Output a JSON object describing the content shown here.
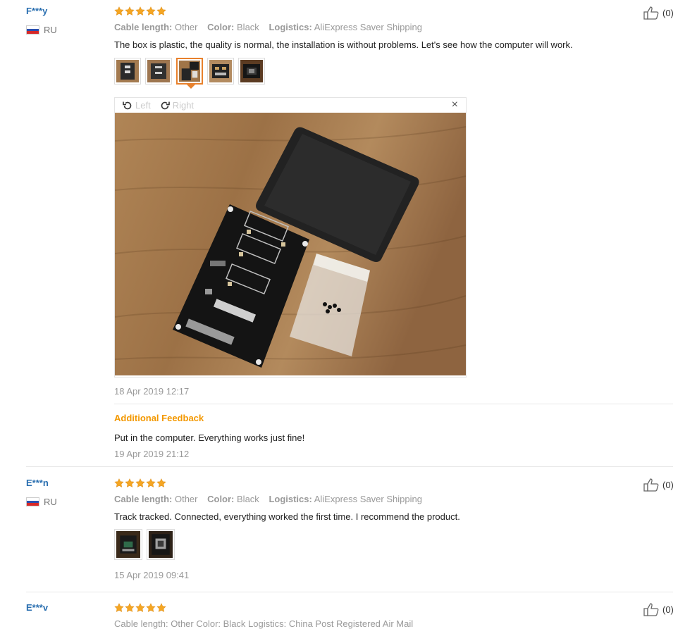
{
  "reviews": [
    {
      "user": "F***y",
      "country": "RU",
      "attrs": {
        "cable_key": "Cable length:",
        "cable_val": "Other",
        "color_key": "Color:",
        "color_val": "Black",
        "logistics_key": "Logistics:",
        "logistics_val": "AliExpress Saver Shipping"
      },
      "text": "The box is plastic, the quality is normal, the installation is without problems. Let's see how the computer will work.",
      "viewer": {
        "left_label": "Left",
        "right_label": "Right",
        "close_glyph": "×"
      },
      "date": "18 Apr 2019 12:17",
      "additional_title": "Additional Feedback",
      "additional_text": "Put in the computer. Everything works just fine!",
      "additional_date": "19 Apr 2019 21:12",
      "likes": "(0)"
    },
    {
      "user": "E***n",
      "country": "RU",
      "attrs": {
        "cable_key": "Cable length:",
        "cable_val": "Other",
        "color_key": "Color:",
        "color_val": "Black",
        "logistics_key": "Logistics:",
        "logistics_val": "AliExpress Saver Shipping"
      },
      "text": "Track tracked. Connected, everything worked the first time. I recommend the product.",
      "date": "15 Apr 2019 09:41",
      "likes": "(0)"
    },
    {
      "user": "E***v",
      "likes": "(0)",
      "attrs_partial": "Cable length: Other   Color: Black   Logistics: China Post Registered Air Mail"
    }
  ],
  "colors": {
    "star": "#f5a623",
    "username": "#2a6fb0",
    "additional": "#f39800",
    "active_thumb": "#e8812c"
  }
}
